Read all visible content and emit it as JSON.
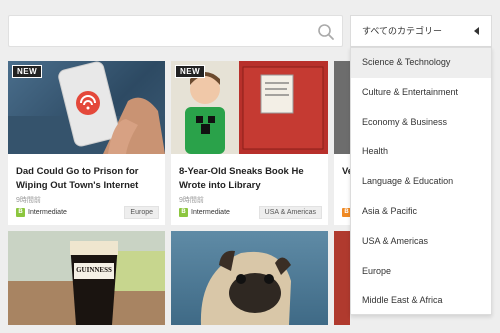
{
  "search": {
    "placeholder": ""
  },
  "category": {
    "selected": "すべてのカテゴリー",
    "options": [
      "Science & Technology",
      "Culture & Entertainment",
      "Economy & Business",
      "Health",
      "Language & Education",
      "Asia & Pacific",
      "USA & Americas",
      "Europe",
      "Middle East & Africa"
    ]
  },
  "articles": [
    {
      "badge": "NEW",
      "title": "Dad Could Go to Prison for Wiping Out Town's Internet",
      "time": "9時間前",
      "level_letter": "B",
      "level": "Intermediate",
      "region": "Europe"
    },
    {
      "badge": "NEW",
      "title": "8-Year-Old Sneaks Book He Wrote into Library",
      "time": "9時間前",
      "level_letter": "B",
      "level": "Intermediate",
      "region": "USA & Americas"
    },
    {
      "title": "Ve",
      "level_letter": "B"
    }
  ],
  "photo_text": {
    "guinness": "GUINNESS"
  },
  "colors": {
    "level_intermediate": "#8cc63f",
    "level_orange": "#f08a24",
    "page_bg": "#eeeeee"
  },
  "icons": {
    "search": "search-icon",
    "dropdown": "caret-left-icon"
  }
}
